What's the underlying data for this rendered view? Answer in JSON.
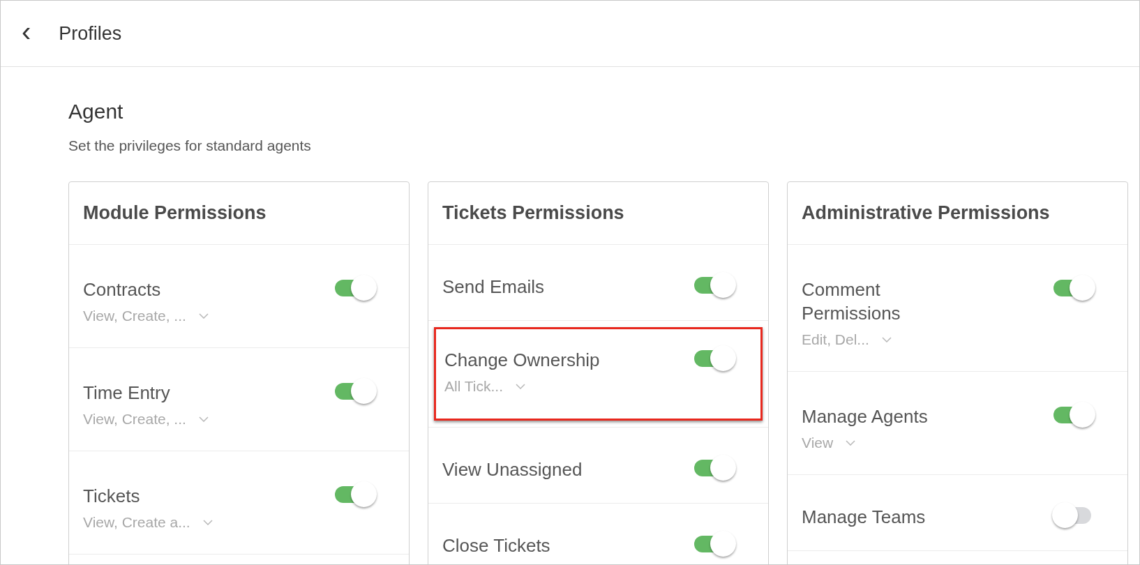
{
  "header": {
    "back_icon": "‹",
    "title": "Profiles"
  },
  "profile": {
    "title": "Agent",
    "description": "Set the privileges for standard agents"
  },
  "panels": [
    {
      "title": "Module Permissions",
      "items": [
        {
          "label": "Contracts",
          "on": true,
          "options": "View, Create, ...",
          "highlighted": false
        },
        {
          "label": "Time Entry",
          "on": true,
          "options": "View, Create, ...",
          "highlighted": false
        },
        {
          "label": "Tickets",
          "on": true,
          "options": "View, Create a...",
          "highlighted": false
        }
      ]
    },
    {
      "title": "Tickets Permissions",
      "items": [
        {
          "label": "Send Emails",
          "on": true,
          "highlighted": false
        },
        {
          "label": "Change Ownership",
          "on": true,
          "options": "All Tick...",
          "highlighted": true
        },
        {
          "label": "View Unassigned",
          "on": true,
          "highlighted": false
        },
        {
          "label": "Close Tickets",
          "on": true,
          "highlighted": false
        }
      ]
    },
    {
      "title": "Administrative Permissions",
      "items": [
        {
          "label": "Comment Permissions",
          "on": true,
          "options": "Edit, Del...",
          "highlighted": false
        },
        {
          "label": "Manage Agents",
          "on": true,
          "options": "View",
          "highlighted": false
        },
        {
          "label": "Manage Teams",
          "on": false,
          "highlighted": false
        }
      ]
    }
  ]
}
